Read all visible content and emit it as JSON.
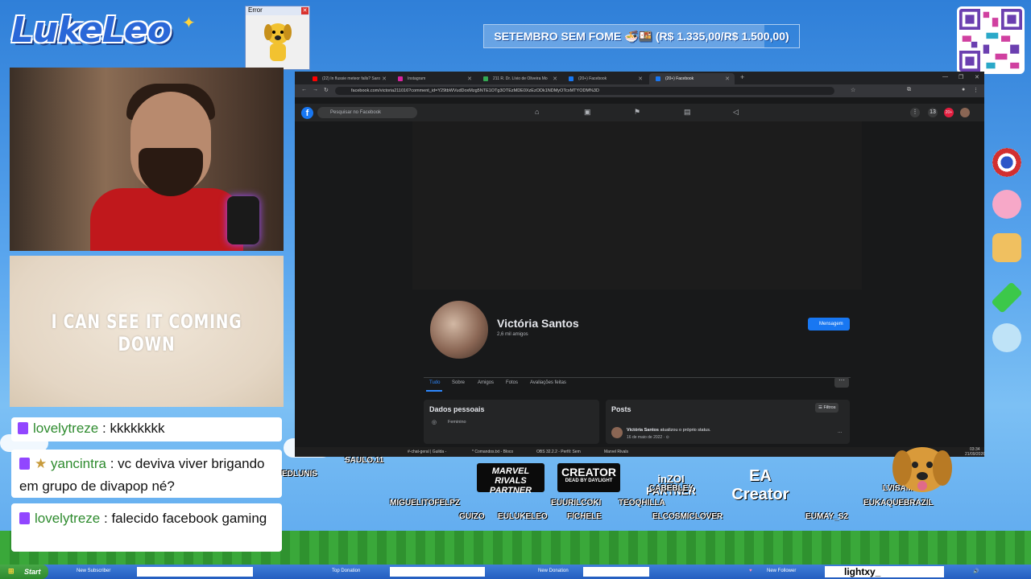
{
  "overlay": {
    "logo_text": "LukeLeo",
    "error_title": "Error",
    "goal_text": "SETEMBRO SEM FOME 🍜🍱 (R$ 1.335,00/R$ 1.500,00)",
    "goal_progress": 0.89
  },
  "camera_overlay": {
    "lyric_text": "I CAN SEE IT COMING DOWN"
  },
  "chat": [
    {
      "user": "lovelytreze",
      "text": "kkkkkkkk"
    },
    {
      "user": "yancintra",
      "text": "vc deviva viver brigando em grupo de divapop né?"
    },
    {
      "user": "lovelytreze",
      "text": "falecido facebook gaming"
    }
  ],
  "browser": {
    "tabs": [
      {
        "title": "(22) In flussie meteor falls? Saro",
        "color": "#ff0000"
      },
      {
        "title": "Instagram",
        "color": "#d6249f"
      },
      {
        "title": "211 R. Dr. Lívio de Oliveira Mo",
        "color": "#34a853"
      },
      {
        "title": "(20+) Facebook",
        "color": "#1877f2"
      },
      {
        "title": "(20+) Facebook",
        "color": "#1877f2"
      }
    ],
    "url": "facebook.com/victoria211016?comment_id=Y29tbWVudDoxMzg5NTE1OTg3OTEzMDE0XzEzODk1NDMyOTcxMTYODM%3D",
    "search_placeholder": "Pesquisar no Facebook",
    "notif_count_messenger": "13",
    "notif_count_bell": "20+"
  },
  "profile": {
    "name": "Victória Santos",
    "friends": "2,6 mil amigos",
    "message_button": "Mensagem",
    "tabs": [
      "Tudo",
      "Sobre",
      "Amigos",
      "Fotos",
      "Avaliações feitas"
    ],
    "more": "···",
    "personal_title": "Dados pessoais",
    "gender": "Feminino",
    "posts_title": "Posts",
    "filters": "Filtros",
    "post_author": "Victória Santos",
    "post_action": "atualizou o próprio status.",
    "post_date": "16 de maio de 2022 · ⊙"
  },
  "inner_taskbar": {
    "items": [
      "#-chat-geral | Guilda -",
      "* Comandos.txt - Bloco",
      "OBS 32.2.2 - Perfil: Sem",
      "Marvel Rivals"
    ],
    "time": "03:34",
    "date": "21/09/2026"
  },
  "sponsors": {
    "rivals": "MARVEL RIVALS PARTNER",
    "creator": "CREATOR",
    "creator_sub": "DEAD BY DAYLIGHT",
    "inzoi": "inZOI PARTNER",
    "ea": "EA Creator"
  },
  "supporter_names": [
    "EDLUNIS",
    "SAULO.11",
    "MIGUELITOFELPZ",
    "EUURILCOKI",
    "TEOQHILLA",
    "CABEBLEY",
    "LVISAM",
    "EUKAQUEBRAZIL",
    "GUIZO",
    "EULUKELEO",
    "FICHELE",
    "ELCOSMICLOVER",
    "EUMAY_S2"
  ],
  "taskbar": {
    "start": "Start",
    "new_subscriber": "New Subscriber",
    "top_donation": "Top Donation",
    "new_donation": "New Donation",
    "new_follower": "New Follower",
    "follower_name": "lightxy_"
  },
  "colors": {
    "facebook_blue": "#1877f2",
    "chat_user": "#2e8b2e",
    "twitch_purple": "#9146ff"
  }
}
